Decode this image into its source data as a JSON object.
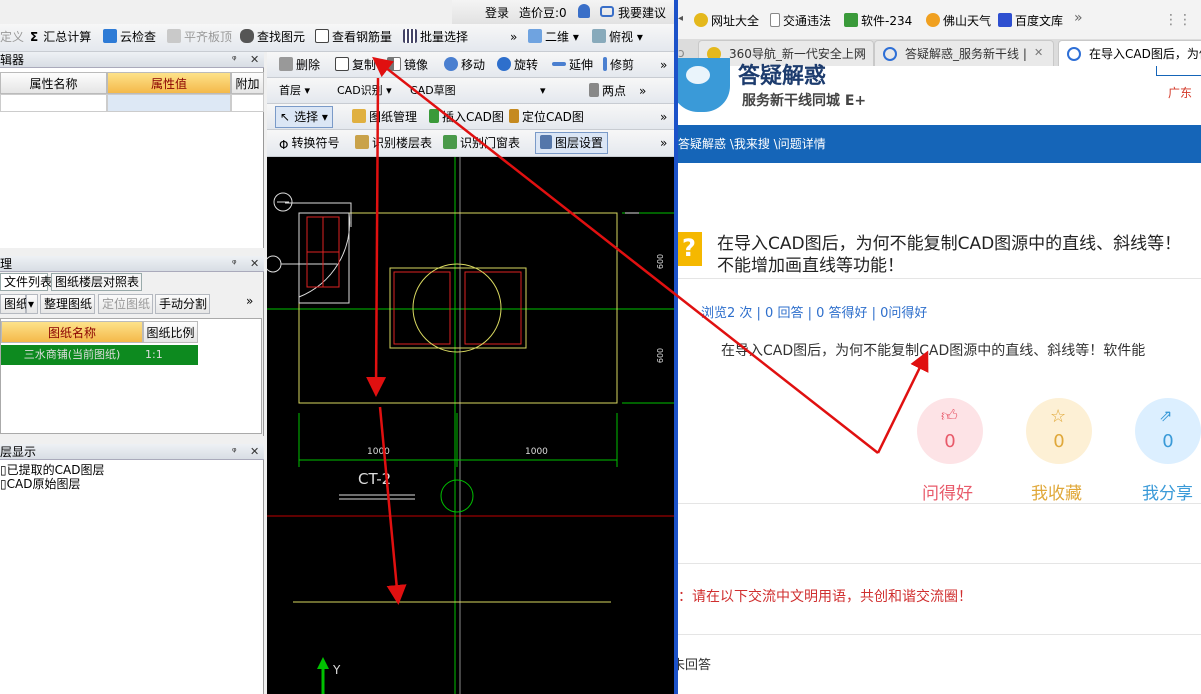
{
  "top_bar": {
    "login": "登录",
    "price_bean": "造价豆:0",
    "suggest": "我要建议"
  },
  "toolbar1": {
    "define": "定义",
    "sum_calc": "汇总计算",
    "cloud_check": "云检查",
    "align_slab": "平齐板顶",
    "find_element": "查找图元",
    "view_rebar": "查看钢筋量",
    "batch_select": "批量选择",
    "more": "»",
    "view_2d": "二维",
    "top_view": "俯视"
  },
  "left_panel1": {
    "title": "辑器",
    "col_name": "属性名称",
    "col_value": "属性值",
    "col_extra": "附加"
  },
  "left_panel2": {
    "title": "理",
    "tab_files": "文件列表",
    "tab_floor": "图纸楼层对照表",
    "btn_drawing": "图纸",
    "btn_organize": "整理图纸",
    "btn_locate": "定位图纸",
    "btn_split": "手动分割",
    "col_name": "图纸名称",
    "col_scale": "图纸比例",
    "row_name": "三水商铺(当前图纸)",
    "row_scale": "1:1"
  },
  "left_panel3": {
    "title": "层显示",
    "item1": "已提取的CAD图层",
    "item2": "CAD原始图层"
  },
  "cad_toolbar": {
    "delete": "删除",
    "copy": "复制",
    "mirror": "镜像",
    "move": "移动",
    "rotate": "旋转",
    "extend": "延伸",
    "trim": "修剪",
    "floor": "首层",
    "cad_recog": "CAD识别",
    "cad_draft": "CAD草图",
    "two_points": "两点",
    "select": "选择",
    "drawing_mgmt": "图纸管理",
    "insert_cad": "插入CAD图",
    "locate_cad": "定位CAD图",
    "convert_symbol": "转换符号",
    "recog_floor_table": "识别楼层表",
    "recog_door_window": "识别门窗表",
    "layer_settings": "图层设置"
  },
  "cad_canvas": {
    "dim_left": "1000",
    "dim_right": "1000",
    "dim_v1": "600",
    "dim_v2": "600",
    "label": "CT-2",
    "axis_y": "Y"
  },
  "browser": {
    "bookmarks": [
      "网址大全",
      "交通违法",
      "软件-234",
      "佛山天气",
      "百度文库"
    ],
    "tabs": [
      "360导航_新一代安全上网",
      "答疑解惑_服务新干线 | ",
      "在导入CAD图后，为何"
    ],
    "site_title": "答疑解惑",
    "site_subtitle": "服务新干线同城 E+",
    "region": "广东",
    "breadcrumb": "答疑解惑 \\我来搜 \\问题详情",
    "question_title_1": "在导入CAD图后，为何不能复制CAD图源中的直线、斜线等！",
    "question_title_2": "不能增加画直线等功能！",
    "stats": "浏览2 次 | 0 回答 | 0 答得好 | 0问得好",
    "question_body": "在导入CAD图后，为何不能复制CAD图源中的直线、斜线等！软件能",
    "actions": [
      {
        "label": "问得好",
        "count": "0"
      },
      {
        "label": "我收藏",
        "count": "0"
      },
      {
        "label": "我分享",
        "count": "0"
      }
    ],
    "notice": "：请在以下交流中文明用语，共创和谐交流圈！",
    "answers_title": "未回答"
  },
  "colors": {
    "arrow": "#e01010",
    "cad_bg": "#000000",
    "cad_green": "#00c000",
    "cad_yellow": "#d8d860",
    "blue_bar": "#1565b8"
  }
}
